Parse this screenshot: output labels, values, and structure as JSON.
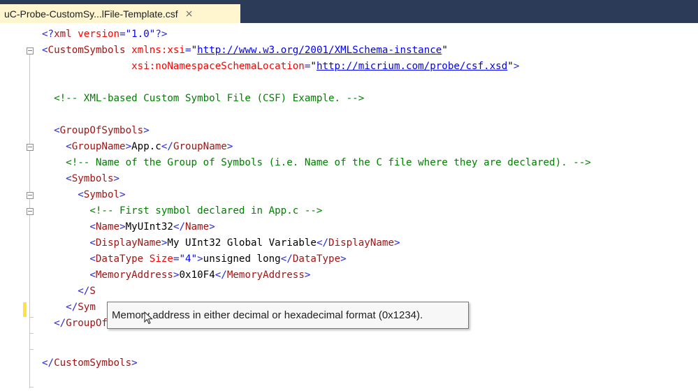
{
  "tab": {
    "title": "uC-Probe-CustomSy...lFile-Template.csf",
    "close_glyph": "×"
  },
  "code": {
    "decl": {
      "open": "<?",
      "name": "xml",
      "attr": "version",
      "eq": "=",
      "value": "\"1.0\"",
      "close": "?>"
    },
    "root_open": {
      "lt": "<",
      "name": "CustomSymbols",
      "attr1": "xmlns:xsi",
      "eq": "=",
      "val1_q": "\"",
      "val1": "http://www.w3.org/2001/XMLSchema-instance",
      "val1_qe": "\""
    },
    "root_open2": {
      "attr2": "xsi:noNamespaceSchemaLocation",
      "eq": "=",
      "q": "\"",
      "val2": "http://micrium.com/probe/csf.xsd",
      "qe": "\"",
      "gt": ">"
    },
    "comment1": "<!-- XML-based Custom Symbol File (CSF) Example. -->",
    "group_open": {
      "lt": "<",
      "name": "GroupOfSymbols",
      "gt": ">"
    },
    "group_name": {
      "lt": "<",
      "name": "GroupName",
      "gt": ">",
      "text": "App.c",
      "clt": "</",
      "cname": "GroupName",
      "cgt": ">"
    },
    "comment2": "<!-- Name of the Group of Symbols (i.e. Name of the C file where they are declared). -->",
    "symbols_open": {
      "lt": "<",
      "name": "Symbols",
      "gt": ">"
    },
    "symbol_open": {
      "lt": "<",
      "name": "Symbol",
      "gt": ">"
    },
    "comment3": "<!-- First symbol declared in App.c -->",
    "name_line": {
      "lt": "<",
      "name": "Name",
      "gt": ">",
      "text": "MyUInt32",
      "clt": "</",
      "cname": "Name",
      "cgt": ">"
    },
    "display_line": {
      "lt": "<",
      "name": "DisplayName",
      "gt": ">",
      "text": "My UInt32 Global Variable",
      "clt": "</",
      "cname": "DisplayName",
      "cgt": ">"
    },
    "datatype_line": {
      "lt": "<",
      "name": "DataType",
      "attr": "Size",
      "eq": "=",
      "val": "\"4\"",
      "gt": ">",
      "text": "unsigned long",
      "clt": "</",
      "cname": "DataType",
      "cgt": ">"
    },
    "memory_line": {
      "lt": "<",
      "name": "MemoryAddress",
      "gt": ">",
      "text": "0x10F4",
      "clt": "</",
      "cname": "MemoryAddress",
      "cgt": ">"
    },
    "symbol_close_partial": {
      "lt": "</",
      "name": "S"
    },
    "symbols_close_partial": {
      "lt": "</",
      "name": "Sym"
    },
    "group_close": {
      "lt": "</",
      "name": "GroupOfSymbols",
      "gt": ">"
    },
    "root_close": {
      "lt": "</",
      "name": "CustomSymbols",
      "gt": ">"
    }
  },
  "tooltip": {
    "text": "Memory address in either decimal or hexadecimal format (0x1234)."
  },
  "colors": {
    "tab_bar": "#2b3b58",
    "active_tab": "#fff6cf",
    "tag": "#a31515",
    "attribute": "#ff0000",
    "value": "#0000ff",
    "comment": "#008000",
    "change_marker": "#ffe047"
  },
  "icons": {
    "fold": "collapse-toggle-icon",
    "cursor": "mouse-pointer-icon"
  }
}
